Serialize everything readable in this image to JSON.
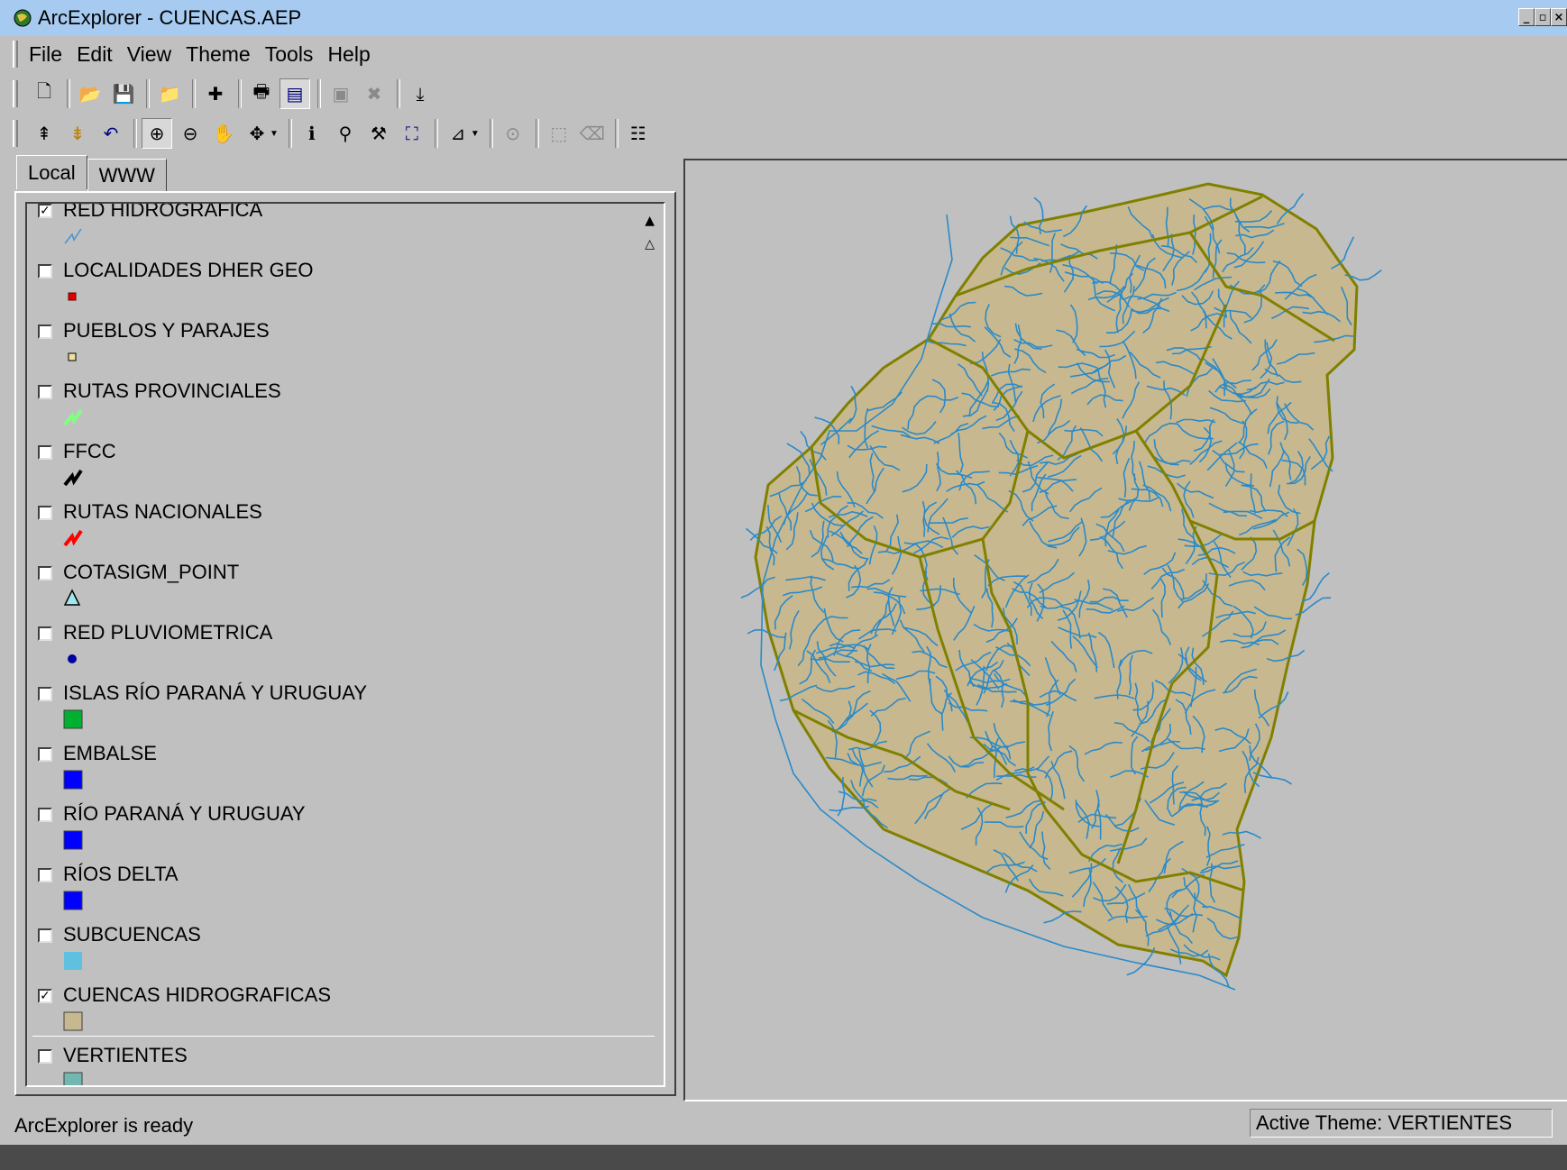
{
  "window": {
    "title": "ArcExplorer - CUENCAS.AEP",
    "controls": [
      "_",
      "▫",
      "×"
    ]
  },
  "menu": [
    {
      "label": "File"
    },
    {
      "label": "Edit"
    },
    {
      "label": "View"
    },
    {
      "label": "Theme"
    },
    {
      "label": "Tools"
    },
    {
      "label": "Help"
    }
  ],
  "toolbar1": [
    {
      "name": "new-project-icon",
      "glyph": "🗋"
    },
    {
      "name": "open-project-icon",
      "glyph": "📂"
    },
    {
      "name": "save-project-icon",
      "glyph": "💾"
    },
    {
      "name": "open-folder-icon",
      "glyph": "📁"
    },
    {
      "name": "add-theme-icon",
      "glyph": "✚"
    },
    {
      "name": "print-icon",
      "glyph": "🖶"
    },
    {
      "name": "legend-toggle-icon",
      "glyph": "▤"
    },
    {
      "name": "copy-map-icon",
      "glyph": "▣"
    },
    {
      "name": "stop-icon",
      "glyph": "✖"
    },
    {
      "name": "export-icon",
      "glyph": "⤓"
    }
  ],
  "toolbar2": [
    {
      "name": "full-extent-icon",
      "glyph": "⇞"
    },
    {
      "name": "zoom-active-theme-icon",
      "glyph": "⇟"
    },
    {
      "name": "previous-extent-icon",
      "glyph": "↶"
    },
    {
      "name": "zoom-in-icon",
      "glyph": "⊕"
    },
    {
      "name": "zoom-out-icon",
      "glyph": "⊖"
    },
    {
      "name": "pan-icon",
      "glyph": "✋"
    },
    {
      "name": "pan-direction-icon",
      "glyph": "✥"
    },
    {
      "name": "identify-icon",
      "glyph": "ℹ"
    },
    {
      "name": "find-icon",
      "glyph": "⚲"
    },
    {
      "name": "query-builder-icon",
      "glyph": "⚒"
    },
    {
      "name": "select-features-icon",
      "glyph": "⛶"
    },
    {
      "name": "measure-icon",
      "glyph": "⊿"
    },
    {
      "name": "buffer-icon",
      "glyph": "⊙"
    },
    {
      "name": "select-by-shape-icon",
      "glyph": "⬚"
    },
    {
      "name": "clear-selection-icon",
      "glyph": "⌫"
    },
    {
      "name": "properties-icon",
      "glyph": "☷"
    }
  ],
  "tabs": [
    {
      "label": "Local",
      "active": true
    },
    {
      "label": "WWW",
      "active": false
    }
  ],
  "themes": [
    {
      "name": "RED HIDROGRAFICA",
      "checked": true,
      "symbol": "line",
      "color": "#4a90d0"
    },
    {
      "name": "LOCALIDADES DHER GEO",
      "checked": false,
      "symbol": "square-small",
      "color": "#e00000"
    },
    {
      "name": "PUEBLOS Y PARAJES",
      "checked": false,
      "symbol": "square-small-outline",
      "color": "#f0e0a0"
    },
    {
      "name": "RUTAS PROVINCIALES",
      "checked": false,
      "symbol": "line-thick",
      "color": "#80ff80"
    },
    {
      "name": "FFCC",
      "checked": false,
      "symbol": "line-thick",
      "color": "#000000"
    },
    {
      "name": "RUTAS NACIONALES",
      "checked": false,
      "symbol": "line-thick",
      "color": "#ff0000"
    },
    {
      "name": "COTASIGM_POINT",
      "checked": false,
      "symbol": "triangle",
      "color": "#a0e8f0"
    },
    {
      "name": "RED PLUVIOMETRICA",
      "checked": false,
      "symbol": "dot",
      "color": "#0000a0"
    },
    {
      "name": "ISLAS RÍO PARANÁ Y URUGUAY",
      "checked": false,
      "symbol": "fill",
      "color": "#00b030"
    },
    {
      "name": "EMBALSE",
      "checked": false,
      "symbol": "fill",
      "color": "#0000ff"
    },
    {
      "name": "RÍO PARANÁ Y URUGUAY",
      "checked": false,
      "symbol": "fill",
      "color": "#0000ff"
    },
    {
      "name": "RÍOS DELTA",
      "checked": false,
      "symbol": "fill",
      "color": "#0000ff"
    },
    {
      "name": "SUBCUENCAS",
      "checked": false,
      "symbol": "fill-flat",
      "color": "#60c0e0"
    },
    {
      "name": "CUENCAS HIDROGRAFICAS",
      "checked": true,
      "symbol": "fill",
      "color": "#c8b890"
    },
    {
      "name": "VERTIENTES",
      "checked": false,
      "symbol": "fill",
      "color": "#70b8b0"
    }
  ],
  "status": {
    "message": "ArcExplorer is ready",
    "active_theme": "Active Theme: VERTIENTES"
  },
  "map": {
    "land_color": "#c8b890",
    "river_color": "#2a8ac8",
    "boundary_color": "#808000",
    "background": "#c0c0c0"
  }
}
